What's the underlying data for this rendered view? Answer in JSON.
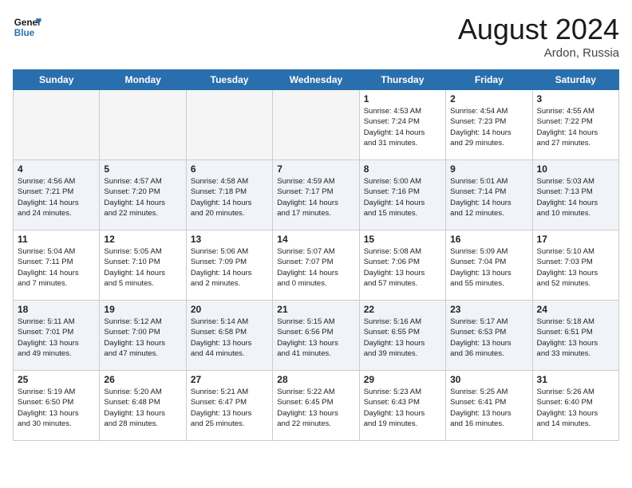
{
  "logo": {
    "line1": "General",
    "line2": "Blue"
  },
  "title": "August 2024",
  "subtitle": "Ardon, Russia",
  "weekdays": [
    "Sunday",
    "Monday",
    "Tuesday",
    "Wednesday",
    "Thursday",
    "Friday",
    "Saturday"
  ],
  "weeks": [
    [
      {
        "day": "",
        "info": ""
      },
      {
        "day": "",
        "info": ""
      },
      {
        "day": "",
        "info": ""
      },
      {
        "day": "",
        "info": ""
      },
      {
        "day": "1",
        "info": "Sunrise: 4:53 AM\nSunset: 7:24 PM\nDaylight: 14 hours\nand 31 minutes."
      },
      {
        "day": "2",
        "info": "Sunrise: 4:54 AM\nSunset: 7:23 PM\nDaylight: 14 hours\nand 29 minutes."
      },
      {
        "day": "3",
        "info": "Sunrise: 4:55 AM\nSunset: 7:22 PM\nDaylight: 14 hours\nand 27 minutes."
      }
    ],
    [
      {
        "day": "4",
        "info": "Sunrise: 4:56 AM\nSunset: 7:21 PM\nDaylight: 14 hours\nand 24 minutes."
      },
      {
        "day": "5",
        "info": "Sunrise: 4:57 AM\nSunset: 7:20 PM\nDaylight: 14 hours\nand 22 minutes."
      },
      {
        "day": "6",
        "info": "Sunrise: 4:58 AM\nSunset: 7:18 PM\nDaylight: 14 hours\nand 20 minutes."
      },
      {
        "day": "7",
        "info": "Sunrise: 4:59 AM\nSunset: 7:17 PM\nDaylight: 14 hours\nand 17 minutes."
      },
      {
        "day": "8",
        "info": "Sunrise: 5:00 AM\nSunset: 7:16 PM\nDaylight: 14 hours\nand 15 minutes."
      },
      {
        "day": "9",
        "info": "Sunrise: 5:01 AM\nSunset: 7:14 PM\nDaylight: 14 hours\nand 12 minutes."
      },
      {
        "day": "10",
        "info": "Sunrise: 5:03 AM\nSunset: 7:13 PM\nDaylight: 14 hours\nand 10 minutes."
      }
    ],
    [
      {
        "day": "11",
        "info": "Sunrise: 5:04 AM\nSunset: 7:11 PM\nDaylight: 14 hours\nand 7 minutes."
      },
      {
        "day": "12",
        "info": "Sunrise: 5:05 AM\nSunset: 7:10 PM\nDaylight: 14 hours\nand 5 minutes."
      },
      {
        "day": "13",
        "info": "Sunrise: 5:06 AM\nSunset: 7:09 PM\nDaylight: 14 hours\nand 2 minutes."
      },
      {
        "day": "14",
        "info": "Sunrise: 5:07 AM\nSunset: 7:07 PM\nDaylight: 14 hours\nand 0 minutes."
      },
      {
        "day": "15",
        "info": "Sunrise: 5:08 AM\nSunset: 7:06 PM\nDaylight: 13 hours\nand 57 minutes."
      },
      {
        "day": "16",
        "info": "Sunrise: 5:09 AM\nSunset: 7:04 PM\nDaylight: 13 hours\nand 55 minutes."
      },
      {
        "day": "17",
        "info": "Sunrise: 5:10 AM\nSunset: 7:03 PM\nDaylight: 13 hours\nand 52 minutes."
      }
    ],
    [
      {
        "day": "18",
        "info": "Sunrise: 5:11 AM\nSunset: 7:01 PM\nDaylight: 13 hours\nand 49 minutes."
      },
      {
        "day": "19",
        "info": "Sunrise: 5:12 AM\nSunset: 7:00 PM\nDaylight: 13 hours\nand 47 minutes."
      },
      {
        "day": "20",
        "info": "Sunrise: 5:14 AM\nSunset: 6:58 PM\nDaylight: 13 hours\nand 44 minutes."
      },
      {
        "day": "21",
        "info": "Sunrise: 5:15 AM\nSunset: 6:56 PM\nDaylight: 13 hours\nand 41 minutes."
      },
      {
        "day": "22",
        "info": "Sunrise: 5:16 AM\nSunset: 6:55 PM\nDaylight: 13 hours\nand 39 minutes."
      },
      {
        "day": "23",
        "info": "Sunrise: 5:17 AM\nSunset: 6:53 PM\nDaylight: 13 hours\nand 36 minutes."
      },
      {
        "day": "24",
        "info": "Sunrise: 5:18 AM\nSunset: 6:51 PM\nDaylight: 13 hours\nand 33 minutes."
      }
    ],
    [
      {
        "day": "25",
        "info": "Sunrise: 5:19 AM\nSunset: 6:50 PM\nDaylight: 13 hours\nand 30 minutes."
      },
      {
        "day": "26",
        "info": "Sunrise: 5:20 AM\nSunset: 6:48 PM\nDaylight: 13 hours\nand 28 minutes."
      },
      {
        "day": "27",
        "info": "Sunrise: 5:21 AM\nSunset: 6:47 PM\nDaylight: 13 hours\nand 25 minutes."
      },
      {
        "day": "28",
        "info": "Sunrise: 5:22 AM\nSunset: 6:45 PM\nDaylight: 13 hours\nand 22 minutes."
      },
      {
        "day": "29",
        "info": "Sunrise: 5:23 AM\nSunset: 6:43 PM\nDaylight: 13 hours\nand 19 minutes."
      },
      {
        "day": "30",
        "info": "Sunrise: 5:25 AM\nSunset: 6:41 PM\nDaylight: 13 hours\nand 16 minutes."
      },
      {
        "day": "31",
        "info": "Sunrise: 5:26 AM\nSunset: 6:40 PM\nDaylight: 13 hours\nand 14 minutes."
      }
    ]
  ]
}
